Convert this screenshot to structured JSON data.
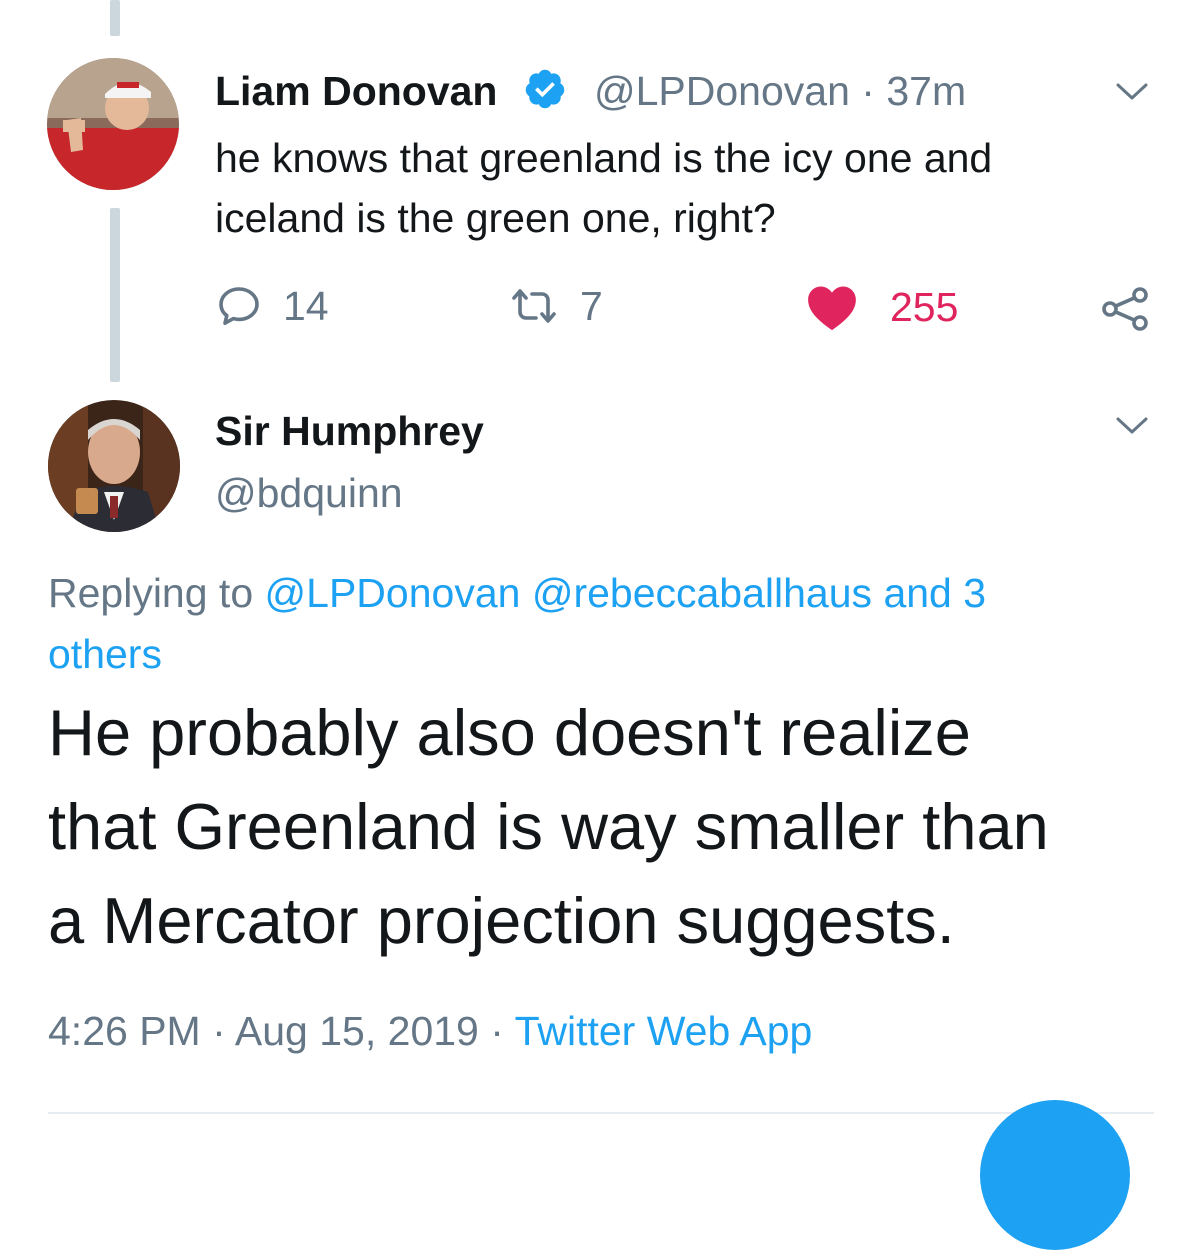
{
  "parent_tweet": {
    "display_name": "Liam Donovan",
    "handle": "@LPDonovan",
    "separator": "·",
    "time": "37m",
    "text_line1": "he knows that greenland is the icy one and",
    "text_line2": "iceland is the green one, right?",
    "replies": "14",
    "retweets": "7",
    "likes": "255",
    "verified": true,
    "liked": true
  },
  "reply_tweet": {
    "display_name": "Sir Humphrey",
    "handle": "@bdquinn",
    "replying_prefix": "Replying to",
    "replying_handle_1": "@LPDonovan",
    "replying_handle_2": "@rebeccaballhaus",
    "replying_others_1": "and 3",
    "replying_others_2": "others",
    "text_line1": "He probably also doesn't realize",
    "text_line2": "that Greenland is way smaller than",
    "text_line3": "a Mercator projection suggests.",
    "time": "4:26 PM",
    "separator": "·",
    "date": "Aug 15, 2019",
    "source": "Twitter Web App"
  },
  "colors": {
    "link": "#1da1f2",
    "secondary_text": "#657786",
    "like": "#e0245e",
    "thread_line": "#ccd6dd"
  },
  "icons": [
    "verified-badge-icon",
    "chevron-down-icon",
    "reply-icon",
    "retweet-icon",
    "heart-icon",
    "share-icon"
  ]
}
